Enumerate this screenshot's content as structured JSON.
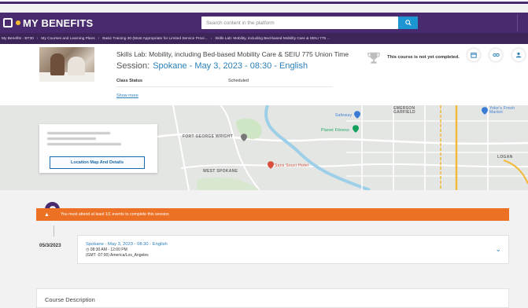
{
  "header": {
    "logo_text": "MY BENEFITS",
    "search_placeholder": "Search content in the platform",
    "search_icon": "search-icon"
  },
  "breadcrumb": [
    "My Benefits - BT30",
    "My Courses and Learning Plans",
    "Basic Training 30 (Most Appropriate for Limited Service Provi...",
    "Skills Lab: Mobility, including Bed-based Mobility Care & SEIU 775 ..."
  ],
  "course": {
    "title": "Skills Lab: Mobility, including Bed-based Mobility Care & SEIU 775 Union Time",
    "session_label": "Session:",
    "session_value": "Spokane - May 3, 2023 - 08:30 - English",
    "status_label": "Class Status",
    "status_value": "Scheduled",
    "show_more": "Show more",
    "completion_text": "This course is not yet completed.",
    "actions": [
      "calendar-icon",
      "link-icon",
      "user-icon"
    ]
  },
  "map": {
    "labels": [
      "FORT GEORGE WRIGHT",
      "WEST SPOKANE",
      "EMERSON GARFIELD",
      "LOGAN",
      "Safeway",
      "Planet Fitness",
      "Yoke's Fresh Market",
      "Sans Souci Hotel"
    ],
    "location_button": "Location Map And Details"
  },
  "warning": {
    "text": "You must attend at least 1/1 events to complete this session"
  },
  "event": {
    "date": "05/3/2023",
    "title": "Spokane - May 3, 2023 - 08:30 - English",
    "time": "08:30 AM - 12:00 PM",
    "timezone": "(GMT -07:00) America/Los_Angeles"
  },
  "description": {
    "title": "Course Description"
  },
  "colors": {
    "brand_purple": "#4a2a6e",
    "warning_orange": "#ec7125",
    "link_blue": "#2a7fb8",
    "search_blue": "#1e95d3"
  }
}
